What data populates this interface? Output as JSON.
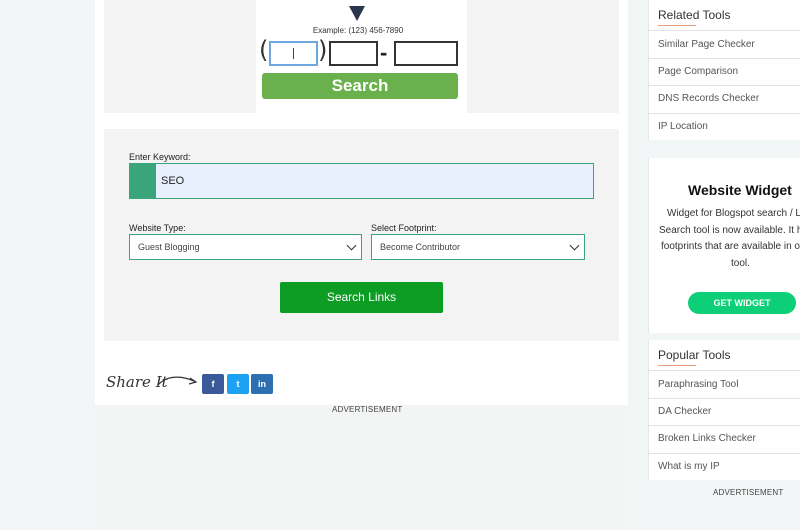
{
  "phone": {
    "example": "Example: (123) 456-7890",
    "open_paren": "(",
    "close_paren": ")",
    "dash": "-",
    "search_label": "Search"
  },
  "form": {
    "keyword_label": "Enter Keyword:",
    "keyword_value": "SEO",
    "website_type_label": "Website Type:",
    "website_type_value": "Guest Blogging",
    "footprint_label": "Select Footprint:",
    "footprint_value": "Become Contributor",
    "submit_label": "Search Links"
  },
  "share": {
    "label": "Share It",
    "buttons": [
      {
        "name": "facebook",
        "glyph": "f",
        "color": "#3b5998"
      },
      {
        "name": "twitter",
        "glyph": "t",
        "color": "#1da1f2"
      },
      {
        "name": "linkedin",
        "glyph": "in",
        "color": "#2d6fb0"
      }
    ]
  },
  "advertisement_label": "ADVERTISEMENT",
  "related_tools": {
    "title": "Related Tools",
    "items": [
      "Similar Page Checker",
      "Page Comparison",
      "DNS Records Checker",
      "IP Location"
    ]
  },
  "widget": {
    "title": "Website Widget",
    "line1": "Widget for Blogspot search / L",
    "line2": "Search tool is now available. It h",
    "line3": "footprints that are available in o",
    "line4": "tool.",
    "button": "GET WIDGET"
  },
  "popular_tools": {
    "title": "Popular Tools",
    "items": [
      "Paraphrasing Tool",
      "DA Checker",
      "Broken Links Checker",
      "What is my IP"
    ]
  },
  "colors": {
    "accent_green": "#3aa57a",
    "search_links_green": "#0d9c24",
    "phone_search_green": "#6ab04c",
    "widget_button": "#0ccf78"
  }
}
